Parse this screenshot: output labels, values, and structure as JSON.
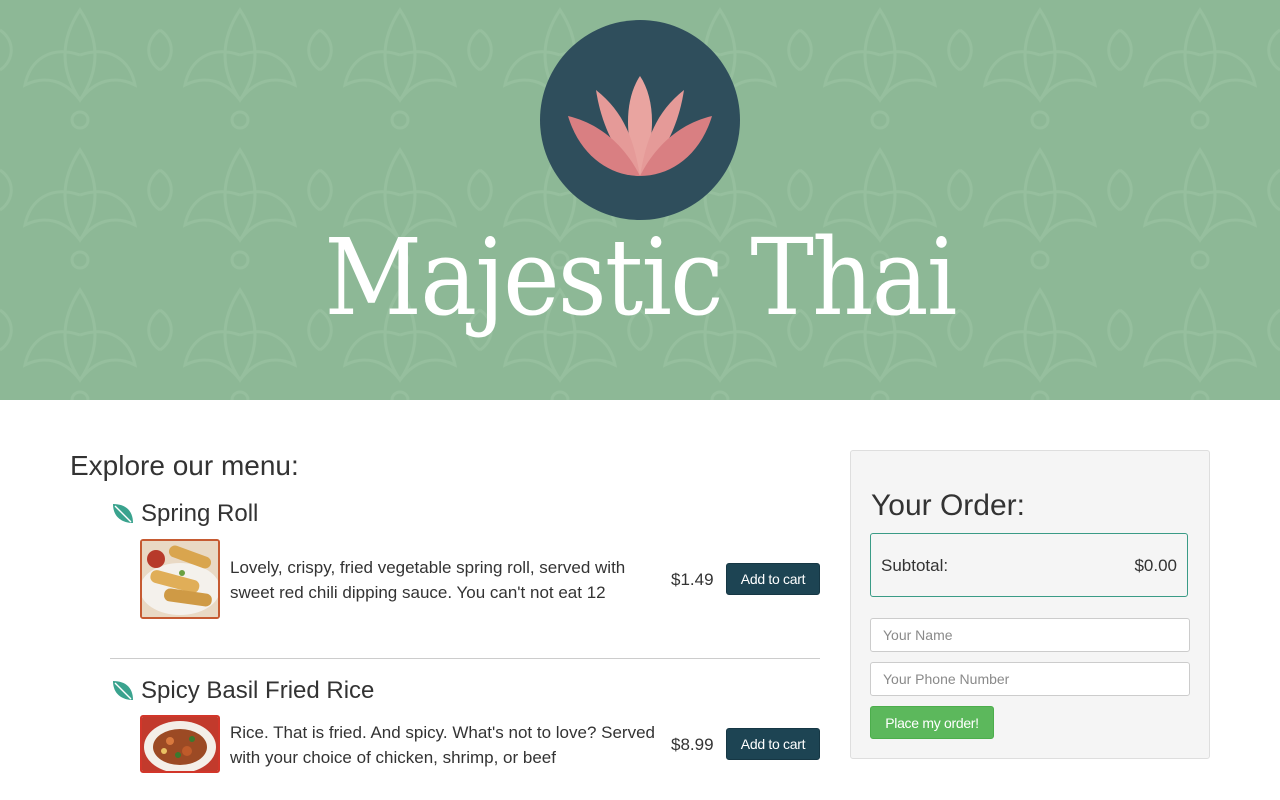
{
  "brand": {
    "name": "Majestic Thai",
    "colors": {
      "hero_bg": "#8db896",
      "logo_circle": "#2f4e5c",
      "lotus_front": "#d97f82",
      "lotus_back": "#e9a4a0",
      "primary_button": "#1d4453",
      "order_button": "#5cb85c",
      "leaf_icon": "#3aa38e"
    }
  },
  "menu": {
    "heading": "Explore our menu:",
    "items": [
      {
        "name": "Spring Roll",
        "description": "Lovely, crispy, fried vegetable spring roll, served with sweet red chili dipping sauce. You can't not eat 12",
        "price": "$1.49",
        "button_label": "Add to cart",
        "icon": "leaf-icon",
        "image": "spring-roll-thumbnail"
      },
      {
        "name": "Spicy Basil Fried Rice",
        "description": "Rice. That is fried. And spicy. What's not to love? Served with your choice of chicken, shrimp, or beef",
        "price": "$8.99",
        "button_label": "Add to cart",
        "icon": "leaf-icon",
        "image": "fried-rice-thumbnail"
      }
    ]
  },
  "order": {
    "heading": "Your Order:",
    "subtotal_label": "Subtotal:",
    "subtotal_value": "$0.00",
    "name_placeholder": "Your Name",
    "phone_placeholder": "Your Phone Number",
    "submit_label": "Place my order!"
  }
}
